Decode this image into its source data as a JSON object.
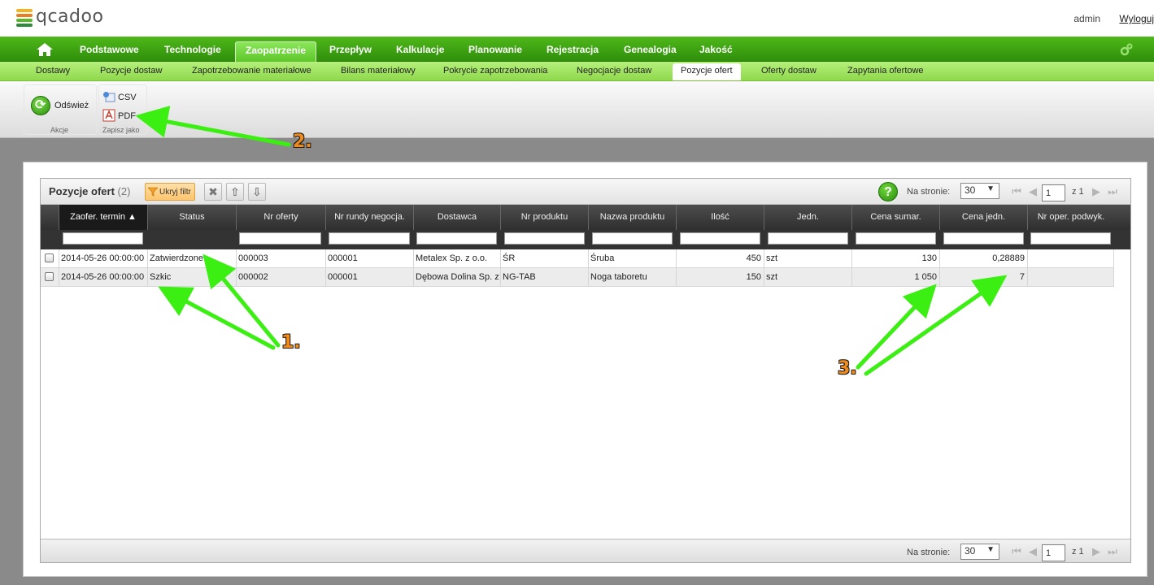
{
  "app": {
    "logo_text": "qcadoo",
    "user": "admin",
    "logout": "Wyloguj"
  },
  "main_nav": [
    {
      "label": "Podstawowe"
    },
    {
      "label": "Technologie"
    },
    {
      "label": "Zaopatrzenie",
      "active": true
    },
    {
      "label": "Przepływ"
    },
    {
      "label": "Kalkulacje"
    },
    {
      "label": "Planowanie"
    },
    {
      "label": "Rejestracja"
    },
    {
      "label": "Genealogia"
    },
    {
      "label": "Jakość"
    }
  ],
  "sub_nav": [
    {
      "label": "Dostawy"
    },
    {
      "label": "Pozycje dostaw"
    },
    {
      "label": "Zapotrzebowanie materiałowe"
    },
    {
      "label": "Bilans materiałowy"
    },
    {
      "label": "Pokrycie zapotrzebowania"
    },
    {
      "label": "Negocjacje dostaw"
    },
    {
      "label": "Pozycje ofert",
      "active": true
    },
    {
      "label": "Oferty dostaw"
    },
    {
      "label": "Zapytania ofertowe"
    }
  ],
  "ribbon": {
    "refresh_label": "Odśwież",
    "actions_group": "Akcje",
    "csv_label": "CSV",
    "pdf_label": "PDF",
    "save_group": "Zapisz jako"
  },
  "grid": {
    "title": "Pozycje ofert",
    "count": "(2)",
    "hide_filter": "Ukryj filtr",
    "per_page_label": "Na stronie:",
    "per_page_value": "30",
    "page": "1",
    "of_label": "z 1",
    "columns": [
      "Zaofer. termin",
      "Status",
      "Nr oferty",
      "Nr rundy negocja.",
      "Dostawca",
      "Nr produktu",
      "Nazwa produktu",
      "Ilość",
      "Jedn.",
      "Cena sumar.",
      "Cena jedn.",
      "Nr oper. podwyk."
    ],
    "rows": [
      [
        "2014-05-26 00:00:00",
        "Zatwierdzone",
        "000003",
        "000001",
        "Metalex Sp. z o.o.",
        "ŚR",
        "Śruba",
        "450",
        "szt",
        "130",
        "0,28889",
        ""
      ],
      [
        "2014-05-26 00:00:00",
        "Szkic",
        "000002",
        "000001",
        "Dębowa Dolina Sp. z o.o.",
        "NG-TAB",
        "Noga taboretu",
        "150",
        "szt",
        "1 050",
        "7",
        ""
      ]
    ]
  },
  "annotations": {
    "n1": "1.",
    "n2": "2.",
    "n3": "3."
  },
  "colors": {
    "nav_green": "#3aa312",
    "subnav_green": "#a4e56a",
    "arrow_green": "#3bef12",
    "callout_orange": "#f28a1a"
  }
}
